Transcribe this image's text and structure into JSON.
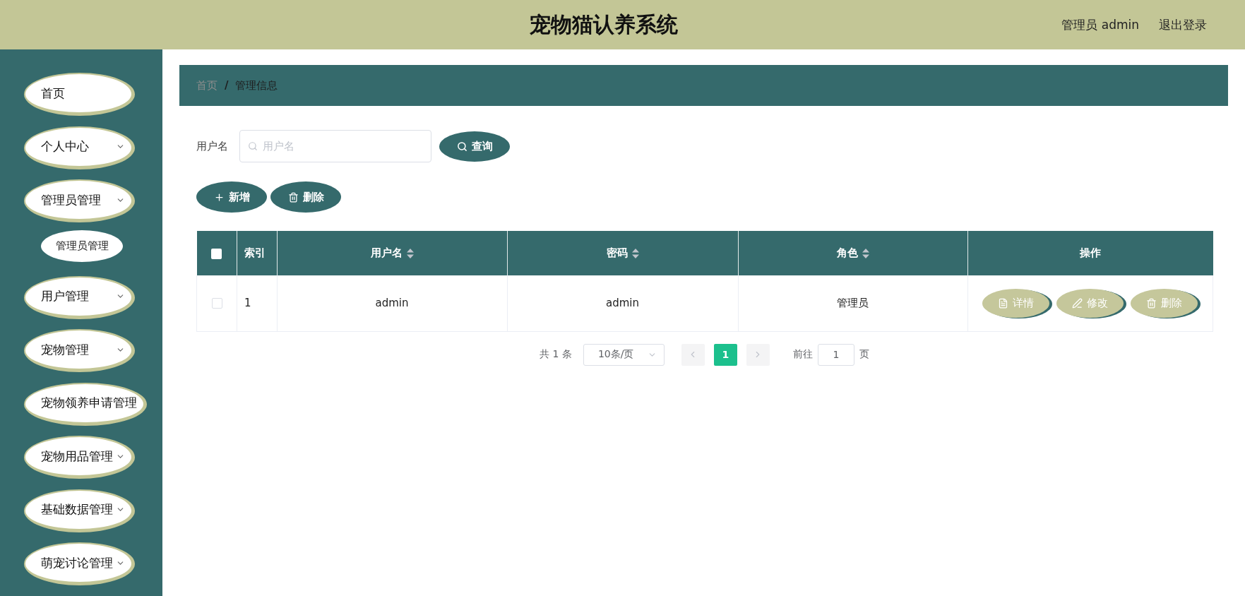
{
  "header": {
    "title": "宠物猫认养系统",
    "user": "管理员 admin",
    "logout": "退出登录"
  },
  "sidebar": {
    "items": [
      {
        "label": "首页",
        "kind": "link"
      },
      {
        "label": "个人中心",
        "kind": "submenu"
      },
      {
        "label": "管理员管理",
        "kind": "submenu",
        "children": [
          {
            "label": "管理员管理"
          }
        ]
      },
      {
        "label": "用户管理",
        "kind": "submenu"
      },
      {
        "label": "宠物管理",
        "kind": "submenu"
      },
      {
        "label": "宠物领养申请管理",
        "kind": "link"
      },
      {
        "label": "宠物用品管理",
        "kind": "submenu"
      },
      {
        "label": "基础数据管理",
        "kind": "submenu"
      },
      {
        "label": "萌宠讨论管理",
        "kind": "submenu"
      }
    ]
  },
  "breadcrumb": {
    "separator": "/",
    "items": [
      {
        "label": "首页",
        "kind": "link"
      },
      {
        "label": "管理信息",
        "kind": "current"
      }
    ]
  },
  "search": {
    "label": "用户名",
    "placeholder": "用户名",
    "button": "查询"
  },
  "actions": [
    {
      "label": "新增",
      "kind": "add"
    },
    {
      "label": "删除",
      "kind": "delete"
    }
  ],
  "table": {
    "select_all": {
      "checked": false
    },
    "columns": [
      {
        "label": "索引",
        "sortable": false
      },
      {
        "label": "用户名",
        "sortable": true
      },
      {
        "label": "密码",
        "sortable": true
      },
      {
        "label": "角色",
        "sortable": true
      },
      {
        "label": "操作",
        "sortable": false
      }
    ],
    "rows": [
      {
        "selected": false,
        "cells": [
          "1",
          "admin",
          "admin",
          "管理员"
        ],
        "actions": [
          {
            "label": "详情",
            "kind": "view"
          },
          {
            "label": "修改",
            "kind": "edit"
          },
          {
            "label": "删除",
            "kind": "delete"
          }
        ]
      }
    ]
  },
  "pagination": {
    "total": "共 1 条",
    "page_size": "10条/页",
    "prev": {
      "disabled": true
    },
    "pages": [
      {
        "label": "1",
        "selected": true
      }
    ],
    "next": {
      "disabled": true
    },
    "jump_label": "前往",
    "jump_value": "1",
    "jump_suffix": "页"
  }
}
